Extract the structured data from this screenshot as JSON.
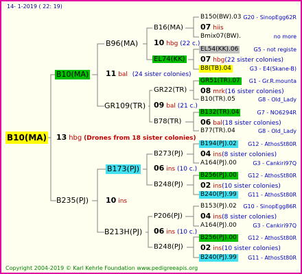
{
  "header": {
    "date": "14-  1-2019 (  22:  19)"
  },
  "root": {
    "name": "B10(MA)",
    "year": "13",
    "breeder": "hbg",
    "note": "(Drones from 18 sister colonies)"
  },
  "gen1": {
    "mother": "B10(MA)",
    "mother_year": "11",
    "mother_breeder": "bal",
    "mother_note": "(24 sister colonies)",
    "father": "B235(PJ)",
    "father_year": "10",
    "father_breeder": "ins"
  },
  "gen2": [
    {
      "name": "B96(MA)",
      "year": "10",
      "breeder": "hbg",
      "note": "(22 c.)"
    },
    {
      "name": "GR109(TR)",
      "year": "09",
      "breeder": "bal",
      "note": "(21 c.)"
    },
    {
      "name": "B173(PJ)",
      "year": "06",
      "breeder": "ins",
      "note": "(10 c.)"
    },
    {
      "name": "B213H(PJ)",
      "year": "06",
      "breeder": "ins",
      "note": "(10 c.)"
    }
  ],
  "gen3": [
    "B16(MA)",
    "EL74(KK)",
    "GR22(TR)",
    "B78(TR)",
    "B273(PJ)",
    "B248(PJ)",
    "P206(PJ)",
    "B248(PJ)"
  ],
  "gen3info": [
    {
      "year": "07",
      "breeder": "hiis",
      "note": ""
    },
    {
      "year": "07",
      "breeder": "hbg",
      "note": "(22 sister colonies)"
    },
    {
      "year": "08",
      "breeder": "mrk",
      "note": "(16 sister colonies)"
    },
    {
      "year": "06",
      "breeder": "bal",
      "note": "(18 sister colonies)"
    },
    {
      "year": "04",
      "breeder": "ins",
      "note": "(8 sister colonies)"
    },
    {
      "year": "02",
      "breeder": "ins",
      "note": "(10 sister colonies)"
    },
    {
      "year": "04",
      "breeder": "ins",
      "note": "(8 sister colonies)"
    },
    {
      "year": "02",
      "breeder": "ins",
      "note": "(10 sister colonies)"
    }
  ],
  "gen4": [
    {
      "name": "B150(BW).03",
      "label": "G20 - SinopEgg62R"
    },
    {
      "name": "Bmix07(BW).",
      "label": "no more"
    },
    {
      "name": "EL54(KK).06",
      "label": "G5 - not registe"
    },
    {
      "name": "B8(TB).04",
      "label": "G3 - E4(Skane-B)"
    },
    {
      "name": "GR51(TR).07",
      "label": "G1 - Gr.R.mounta"
    },
    {
      "name": "B10(TR).05",
      "label": "G8 - Old_Lady"
    },
    {
      "name": "B132(TR).04",
      "label": "G7 - NO6294R"
    },
    {
      "name": "B77(TR).04",
      "label": "G8 - Old_Lady"
    },
    {
      "name": "B194(PJ).02",
      "label": "G12 - AthosSt80R"
    },
    {
      "name": "A164(PJ).00",
      "label": "G3 - Cankiri97Q"
    },
    {
      "name": "B256(PJ).00",
      "label": "G12 - AthosSt80R"
    },
    {
      "name": "B240(PJ).99",
      "label": "G11 - AthosSt80R"
    },
    {
      "name": "B153(PJ).02",
      "label": "G10 - SinopEgg86R"
    },
    {
      "name": "A164(PJ).00",
      "label": "G3 - Cankiri97Q"
    },
    {
      "name": "B256(PJ).00",
      "label": "G12 - AthosSt80R"
    },
    {
      "name": "B240(PJ).99",
      "label": "G11 - AthosSt80R"
    }
  ],
  "footer": "Copyright 2004-2019 © Karl Kehrle Foundation    www.pedigreeapis.org",
  "colors": {
    "frame": "#e000a0",
    "highlight_green": "#00c000",
    "highlight_cyan": "#40e0f0",
    "highlight_yellow": "#ffff00",
    "breeder_red": "#c00000",
    "label_blue": "#0000c0"
  }
}
